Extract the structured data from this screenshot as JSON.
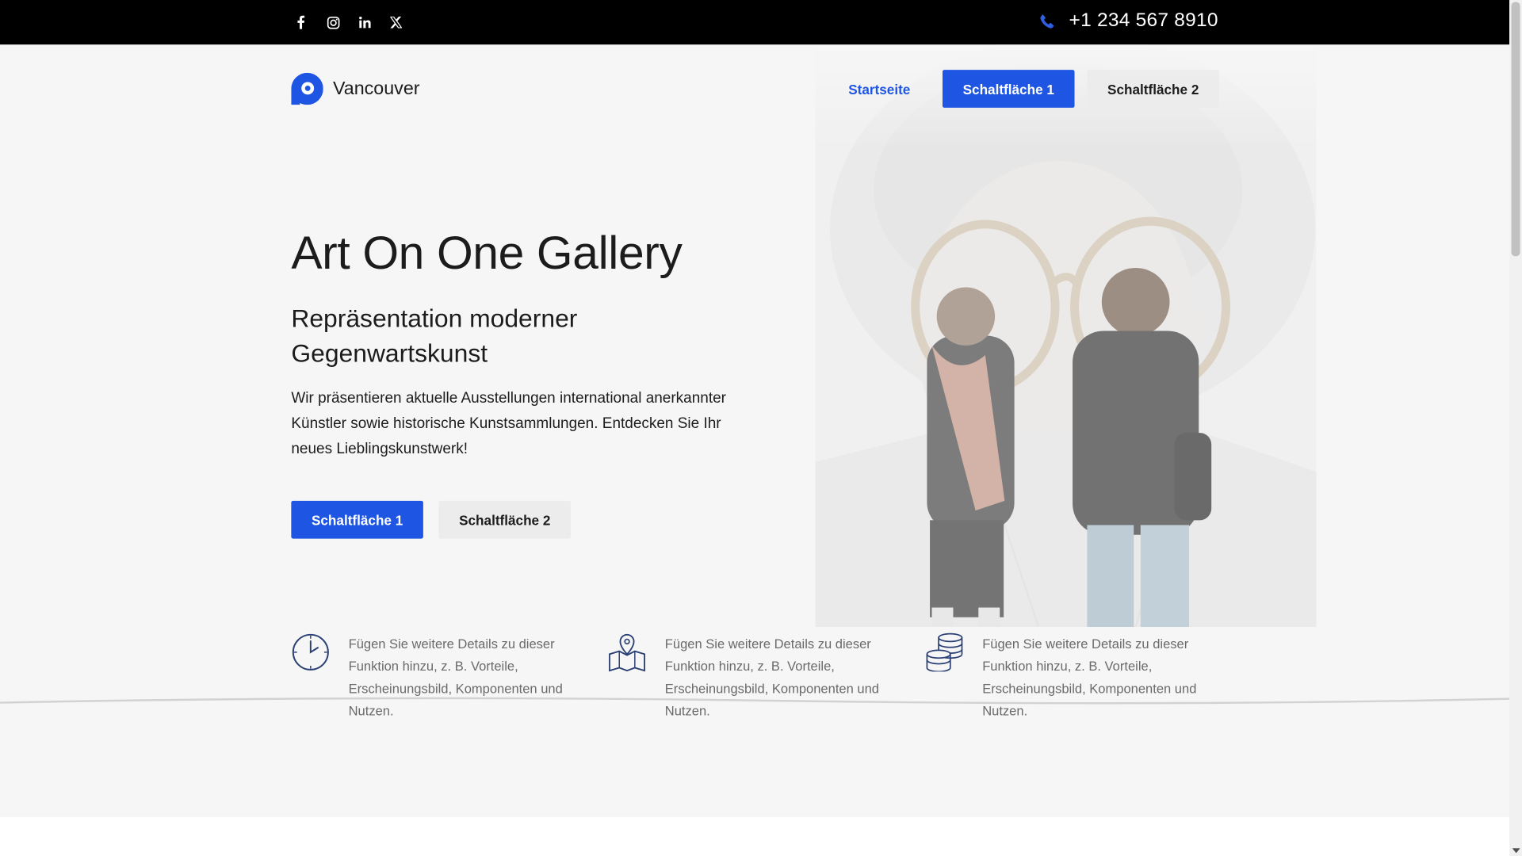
{
  "topbar": {
    "social": [
      {
        "name": "facebook-icon",
        "glyph": "f"
      },
      {
        "name": "instagram-icon",
        "glyph": ""
      },
      {
        "name": "linkedin-icon",
        "glyph": "in"
      },
      {
        "name": "x-twitter-icon",
        "glyph": "𝕏"
      }
    ],
    "phone": "+1 234 567 8910"
  },
  "header": {
    "brand_name": "Vancouver",
    "nav_home": "Startseite",
    "nav_button_1": "Schaltfläche 1",
    "nav_button_2": "Schaltfläche 2"
  },
  "hero": {
    "title": "Art On One Gallery",
    "subtitle": "Repräsentation moderner Gegenwartskunst",
    "lead": "Wir präsentieren aktuelle Ausstellungen international anerkannter Künstler sowie historische Kunstsammlungen. Entdecken Sie Ihr neues Lieblingskunstwerk!",
    "button_1": "Schaltfläche 1",
    "button_2": "Schaltfläche 2"
  },
  "features": [
    {
      "icon": "clock-icon",
      "text": "Fügen Sie weitere Details zu dieser Funktion hinzu, z. B. Vorteile, Erscheinungsbild, Komponenten und Nutzen."
    },
    {
      "icon": "map-pin-icon",
      "text": "Fügen Sie weitere Details zu dieser Funktion hinzu, z. B. Vorteile, Erscheinungsbild, Komponenten und Nutzen."
    },
    {
      "icon": "coins-stack-icon",
      "text": "Fügen Sie weitere Details zu dieser Funktion hinzu, z. B. Vorteile, Erscheinungsbild, Komponenten und Nutzen."
    }
  ],
  "colors": {
    "accent": "#1e55e3",
    "topbar": "#000000",
    "hero_bg": "#f6f6f7"
  }
}
